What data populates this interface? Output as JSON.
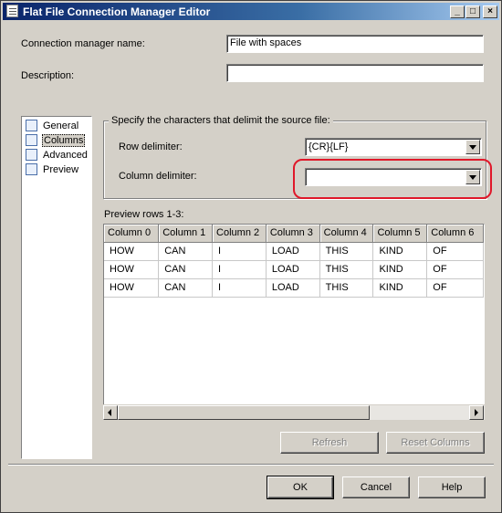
{
  "window": {
    "title": "Flat File Connection Manager Editor",
    "controls": {
      "minimize": "_",
      "maximize": "□",
      "close": "×"
    }
  },
  "form": {
    "connection_name_label": "Connection manager name:",
    "connection_name_value": "File with spaces",
    "description_label": "Description:",
    "description_value": ""
  },
  "nav": {
    "items": [
      {
        "label": "General",
        "icon": "general-icon"
      },
      {
        "label": "Columns",
        "icon": "columns-icon",
        "selected": true
      },
      {
        "label": "Advanced",
        "icon": "advanced-icon"
      },
      {
        "label": "Preview",
        "icon": "preview-icon"
      }
    ]
  },
  "delimiters": {
    "group_title": "Specify the characters that delimit the source file:",
    "row_label": "Row delimiter:",
    "row_value": "{CR}{LF}",
    "column_label": "Column delimiter:",
    "column_value": "",
    "highlight_color": "#e0182a"
  },
  "preview": {
    "label": "Preview rows 1-3:",
    "columns": [
      "Column 0",
      "Column 1",
      "Column 2",
      "Column 3",
      "Column 4",
      "Column 5",
      "Column 6"
    ],
    "rows": [
      [
        "HOW",
        "CAN",
        "I",
        "LOAD",
        "THIS",
        "KIND",
        "OF"
      ],
      [
        "HOW",
        "CAN",
        "I",
        "LOAD",
        "THIS",
        "KIND",
        "OF"
      ],
      [
        "HOW",
        "CAN",
        "I",
        "LOAD",
        "THIS",
        "KIND",
        "OF"
      ]
    ]
  },
  "buttons": {
    "refresh": "Refresh",
    "reset_columns": "Reset Columns",
    "ok": "OK",
    "cancel": "Cancel",
    "help": "Help"
  }
}
